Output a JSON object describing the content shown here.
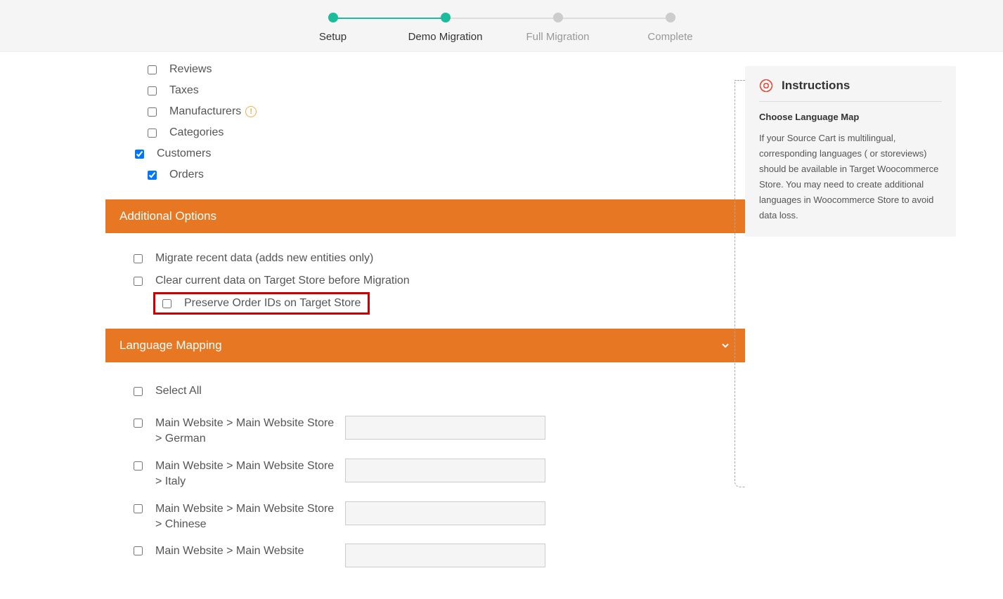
{
  "stepper": {
    "steps": [
      {
        "label": "Setup",
        "state": "done"
      },
      {
        "label": "Demo Migration",
        "state": "active"
      },
      {
        "label": "Full Migration",
        "state": "pending"
      },
      {
        "label": "Complete",
        "state": "pending"
      }
    ]
  },
  "entities": {
    "items": [
      {
        "label": "Reviews",
        "checked": false,
        "indent": 1
      },
      {
        "label": "Taxes",
        "checked": false,
        "indent": 1
      },
      {
        "label": "Manufacturers",
        "checked": false,
        "indent": 1,
        "info": true
      },
      {
        "label": "Categories",
        "checked": false,
        "indent": 1
      },
      {
        "label": "Customers",
        "checked": true,
        "indent": 0
      },
      {
        "label": "Orders",
        "checked": true,
        "indent": 1
      }
    ]
  },
  "sections": {
    "additional_options": "Additional Options",
    "language_mapping": "Language Mapping"
  },
  "additional_options": {
    "items": [
      {
        "label": "Migrate recent data (adds new entities only)",
        "checked": false,
        "highlighted": false
      },
      {
        "label": "Clear current data on Target Store before Migration",
        "checked": false,
        "highlighted": false
      },
      {
        "label": "Preserve Order IDs on Target Store",
        "checked": false,
        "highlighted": true
      }
    ]
  },
  "language_mapping": {
    "select_all_label": "Select All",
    "rows": [
      {
        "label": "Main Website > Main Website Store > German",
        "value": ""
      },
      {
        "label": "Main Website > Main Website Store > Italy",
        "value": ""
      },
      {
        "label": "Main Website > Main Website Store > Chinese",
        "value": ""
      },
      {
        "label": "Main Website > Main Website",
        "value": ""
      }
    ]
  },
  "instructions": {
    "title": "Instructions",
    "subtitle": "Choose Language Map",
    "body": "If your Source Cart is multilingual, corresponding languages ( or storeviews) should be available in Target Woocommerce Store. You may need to create additional languages in Woocommerce Store to avoid data loss."
  }
}
